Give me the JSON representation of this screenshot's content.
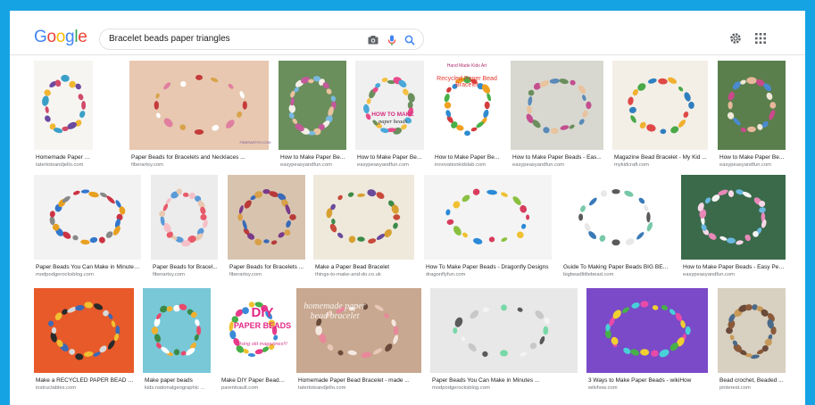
{
  "search": {
    "logo_letters": [
      "G",
      "o",
      "o",
      "g",
      "l",
      "e"
    ],
    "logo_colors": [
      "#4285f4",
      "#ea4335",
      "#fbbc05",
      "#4285f4",
      "#34a853",
      "#ea4335"
    ],
    "query": "Bracelet beads paper triangles",
    "icons": [
      "camera-icon",
      "microphone-icon",
      "search-icon"
    ]
  },
  "header_icons": [
    "settings-icon",
    "apps-grid-icon"
  ],
  "thumb_texts": {
    "how_to_make": "HOW TO MAKE",
    "paper_beads_small": "paper beads",
    "hand_made_kids": "Hand Made Kids Art",
    "recycled_bracelet": "Recycled Paper Bead Bracelet",
    "diy": "DIY",
    "paper_beads_big": "PAPER BEADS",
    "using_magazines": "Using old magazines!!!",
    "homemade_paper_bead_bracelet": "homemade paper bead bracelet",
    "fiberartsy_watermark": "FIBERARTSY.COM"
  },
  "results": [
    {
      "caption": "Homemade Paper Bead Brace...",
      "source": "tatertotsandjello.com",
      "colors": [
        "#f7f5f2",
        "#d24b6b",
        "#3aa0c8",
        "#f2b632",
        "#6b4aa0"
      ]
    },
    {
      "caption": "Paper Beads for Bracelets and Necklaces ...",
      "source": "fiberartsy.com",
      "colors": [
        "#e8c8b0",
        "#c43b3b",
        "#d9a34a",
        "#e07fa0",
        "#ffffff"
      ]
    },
    {
      "caption": "How to Make Paper Be...",
      "source": "easypeasyandfun.com",
      "colors": [
        "#6a8f5c",
        "#c25a9a",
        "#e8c39e",
        "#7ab8e0",
        "#f4f0e8"
      ]
    },
    {
      "caption": "How to Make Paper Be...",
      "source": "easypeasyandfun.com",
      "colors": [
        "#f0f0f0",
        "#6a8f5c",
        "#e84a8a",
        "#4aa8d8",
        "#f4c042"
      ]
    },
    {
      "caption": "How to Make Paper Be...",
      "source": "innovationkidslab.com",
      "colors": [
        "#ffffff",
        "#d43c3c",
        "#2e8bd0",
        "#f0a020",
        "#48b048"
      ]
    },
    {
      "caption": "How to Make Paper Beads - Eas...",
      "source": "easypeasyandfun.com",
      "colors": [
        "#d8d8d0",
        "#c34f8f",
        "#e8c39e",
        "#5a8ab8",
        "#6a8f5c"
      ]
    },
    {
      "caption": "Magazine Bead Bracelet - My Kid ...",
      "source": "mykidcraft.com",
      "colors": [
        "#f3efe6",
        "#2f7fc0",
        "#e04848",
        "#f0b030",
        "#4aa848"
      ]
    },
    {
      "caption": "How to Make Paper Be...",
      "source": "easypeasyandfun.com",
      "colors": [
        "#5a7f4c",
        "#e8b89a",
        "#c84a8a",
        "#4a8ad0",
        "#f0e8d8"
      ]
    },
    {
      "caption": "Paper Beads You Can Make in Minutes...",
      "source": "modpodgerocksblog.com",
      "colors": [
        "#f2f2f2",
        "#cc3344",
        "#3377cc",
        "#e8a020",
        "#888888"
      ]
    },
    {
      "caption": "Paper Beads for Bracel...",
      "source": "fiberartsy.com",
      "colors": [
        "#ececec",
        "#e85a6a",
        "#f6c0c8",
        "#5a9ad8",
        "#e8c8b0"
      ]
    },
    {
      "caption": "Paper Beads for Bracelets ...",
      "source": "fiberartsy.com",
      "colors": [
        "#d8c4ae",
        "#b83a3a",
        "#3a6ab8",
        "#d8a048",
        "#7a3a8a"
      ]
    },
    {
      "caption": "Make a Paper Bead Bracelet",
      "source": "things-to-make-and-do.co.uk",
      "colors": [
        "#efe9dc",
        "#c84a3a",
        "#3a8a48",
        "#d8a030",
        "#6a4a9a"
      ]
    },
    {
      "caption": "How To Make Paper Beads - Dragonfly Designs",
      "source": "dragonflyfun.com",
      "colors": [
        "#f4f4f4",
        "#d83c5c",
        "#2a8ad8",
        "#f0c030",
        "#8ac040"
      ]
    },
    {
      "caption": "Guide To Making Paper Beads BIG BEA...",
      "source": "bigbeadlittlebead.com",
      "colors": [
        "#ffffff",
        "#5a5a5a",
        "#78c8a8",
        "#3a7ab8",
        "#e8e8e8"
      ]
    },
    {
      "caption": "How to Make Paper Beads - Easy Pea...",
      "source": "easypeasyandfun.com",
      "colors": [
        "#3a6a4a",
        "#e888b8",
        "#f8d8e8",
        "#6ab8e0",
        "#f4f4f4"
      ]
    },
    {
      "caption": "Make a RECYCLED PAPER BEAD Br...",
      "source": "instructables.com",
      "colors": [
        "#e85a2a",
        "#3a6ab8",
        "#f0c030",
        "#2a2a2a",
        "#d8d8d8"
      ]
    },
    {
      "caption": "Make paper beads",
      "source": "kids.nationalgeographic ...",
      "colors": [
        "#78c8d8",
        "#e84a6a",
        "#3a8a48",
        "#f0b030",
        "#ffffff"
      ]
    },
    {
      "caption": "Make DIY Paper Beads ...",
      "source": "parentvault.com",
      "colors": [
        "#ffffff",
        "#e83a8a",
        "#3a8ad8",
        "#f0c030",
        "#48b048"
      ]
    },
    {
      "caption": "Homemade Paper Bead Bracelet - made ...",
      "source": "tatertotsandjello.com",
      "colors": [
        "#c8a890",
        "#e8889a",
        "#f4e8e0",
        "#6a4a3a",
        "#e8c8b8"
      ]
    },
    {
      "caption": "Paper Beads You Can Make in Minutes ...",
      "source": "modpodgerocksblog.com",
      "colors": [
        "#e8e8e8",
        "#78d8a8",
        "#5a5a5a",
        "#c8c8c8",
        "#f4f4f4"
      ]
    },
    {
      "caption": "3 Ways to Make Paper Beads - wikiHow",
      "source": "wikihow.com",
      "colors": [
        "#7a4ac8",
        "#48d0d8",
        "#e84aa8",
        "#f0d030",
        "#48b048"
      ]
    },
    {
      "caption": "Bead crochet, Beaded ...",
      "source": "pinterest.com",
      "colors": [
        "#d8d0c0",
        "#8a5a3a",
        "#4a6a8a",
        "#c89a5a",
        "#6a4a3a"
      ]
    }
  ]
}
